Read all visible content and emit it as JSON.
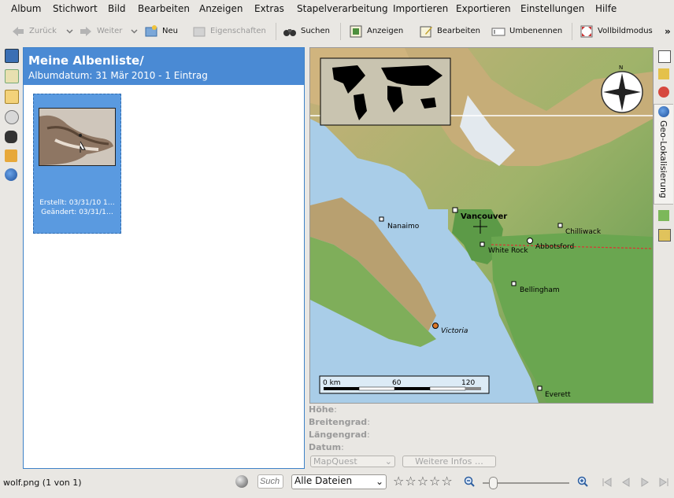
{
  "menu": [
    "Album",
    "Stichwort",
    "Bild",
    "Bearbeiten",
    "Anzeigen",
    "Extras",
    "Stapelverarbeitung",
    "Importieren",
    "Exportieren",
    "Einstellungen",
    "Hilfe"
  ],
  "toolbar": {
    "back": "Zurück",
    "forward": "Weiter",
    "new": "Neu",
    "properties": "Eigenschaften",
    "search": "Suchen",
    "view": "Anzeigen",
    "edit": "Bearbeiten",
    "rename": "Umbenennen",
    "fullscreen": "Vollbildmodus",
    "more": "»"
  },
  "album": {
    "title": "Meine Albenliste/",
    "subtitle": "Albumdatum: 31 Mär 2010 - 1 Eintrag",
    "item": {
      "created": "Erstellt: 03/31/10 1…",
      "modified": "Geändert: 03/31/1…"
    }
  },
  "map": {
    "cities": [
      "Vancouver",
      "Nanaimo",
      "Chilliwack",
      "White Rock",
      "Abbotsford",
      "Bellingham",
      "Victoria",
      "Everett"
    ],
    "scale": {
      "unit": "0 km",
      "mid": "60",
      "max": "120"
    },
    "compass": "N"
  },
  "geo": {
    "altitude": "Höhe",
    "latitude": "Breitengrad",
    "longitude": "Längengrad",
    "date": "Datum",
    "provider": "MapQuest",
    "more_info": "Weitere Infos …"
  },
  "sidebar_tab": "Geo-Lokalisierung",
  "status": {
    "file": "wolf.png (1 von 1)",
    "search_placeholder": "Such",
    "filter": "Alle Dateien",
    "stars": "☆☆☆☆☆"
  },
  "colors": {
    "selection": "#4a8ad4",
    "water": "#a8cbe6",
    "land": "#6a9e4f"
  }
}
